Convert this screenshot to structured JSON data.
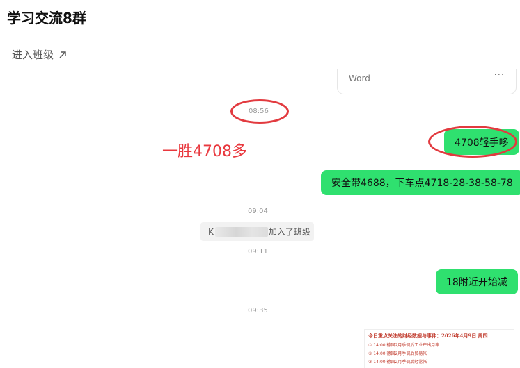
{
  "header": {
    "title": "学习交流8群",
    "enter_class_label": "进入班级",
    "arrow_icon": "arrow-up-right-icon"
  },
  "file_card": {
    "type_label": "Word",
    "more_label": "···"
  },
  "messages": {
    "time_1": "08:56",
    "bubble_1": "4708轻手哆",
    "bubble_2": "安全带4688，下车点4718-28-38-58-78",
    "time_2": "09:04",
    "notice_prefix": "K",
    "notice_suffix": "加入了班级",
    "time_3": "09:11",
    "bubble_3": "18附近开始减",
    "time_4": "09:35"
  },
  "annotation": {
    "text": "一胜4708多",
    "color": "#e9383e"
  },
  "doc_image": {
    "title": "今日重点关注的财经数据与事件：2026年4月9日 周四",
    "lines": [
      "① 14:00 德国2月季调后工业产出月率",
      "② 14:00 德国2月季调后贸易帐",
      "③ 14:00 德国2月季调后经常帐"
    ]
  },
  "colors": {
    "bubble_green": "#2fe06f",
    "annotation_red": "#e23a3f"
  }
}
